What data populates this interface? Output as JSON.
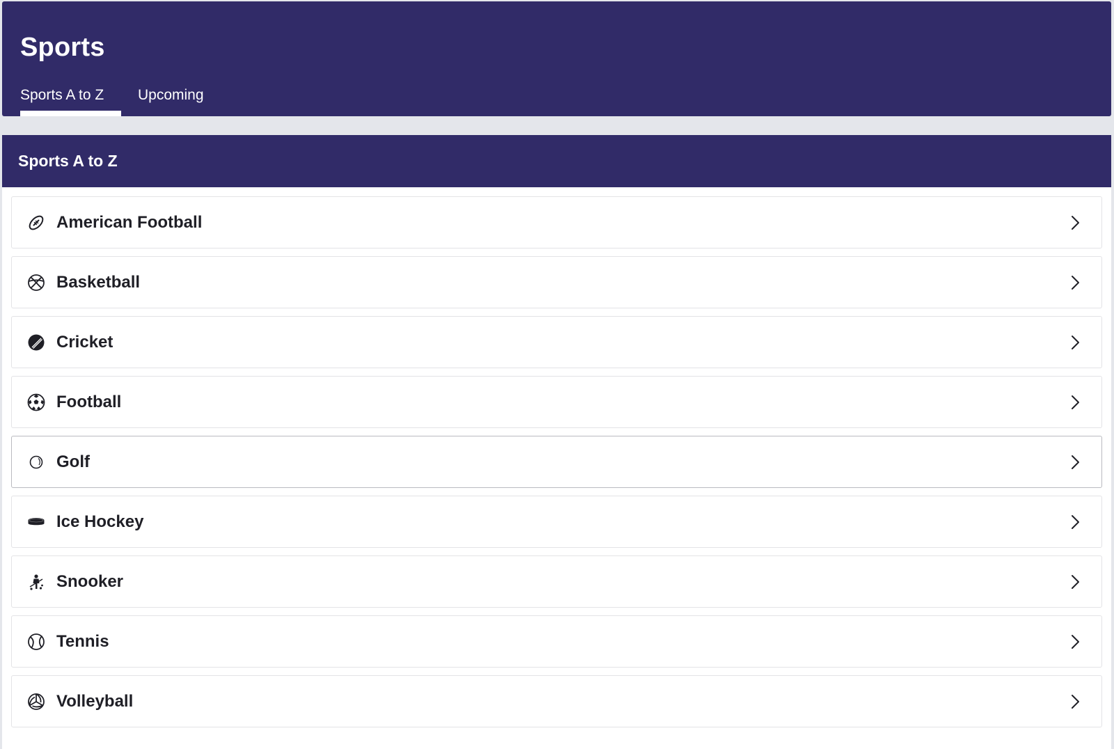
{
  "header": {
    "title": "Sports",
    "tabs": [
      {
        "label": "Sports A to Z",
        "active": true
      },
      {
        "label": "Upcoming",
        "active": false
      }
    ]
  },
  "section": {
    "title": "Sports A to Z",
    "items": [
      {
        "label": "American Football",
        "icon": "american-football-icon"
      },
      {
        "label": "Basketball",
        "icon": "basketball-icon"
      },
      {
        "label": "Cricket",
        "icon": "cricket-ball-icon"
      },
      {
        "label": "Football",
        "icon": "soccer-ball-icon"
      },
      {
        "label": "Golf",
        "icon": "golf-ball-icon"
      },
      {
        "label": "Ice Hockey",
        "icon": "hockey-puck-icon"
      },
      {
        "label": "Snooker",
        "icon": "snooker-icon"
      },
      {
        "label": "Tennis",
        "icon": "tennis-ball-icon"
      },
      {
        "label": "Volleyball",
        "icon": "volleyball-icon"
      }
    ]
  },
  "colors": {
    "brand": "#312b68",
    "background": "#e4e6eb",
    "text": "#1f1f26"
  }
}
